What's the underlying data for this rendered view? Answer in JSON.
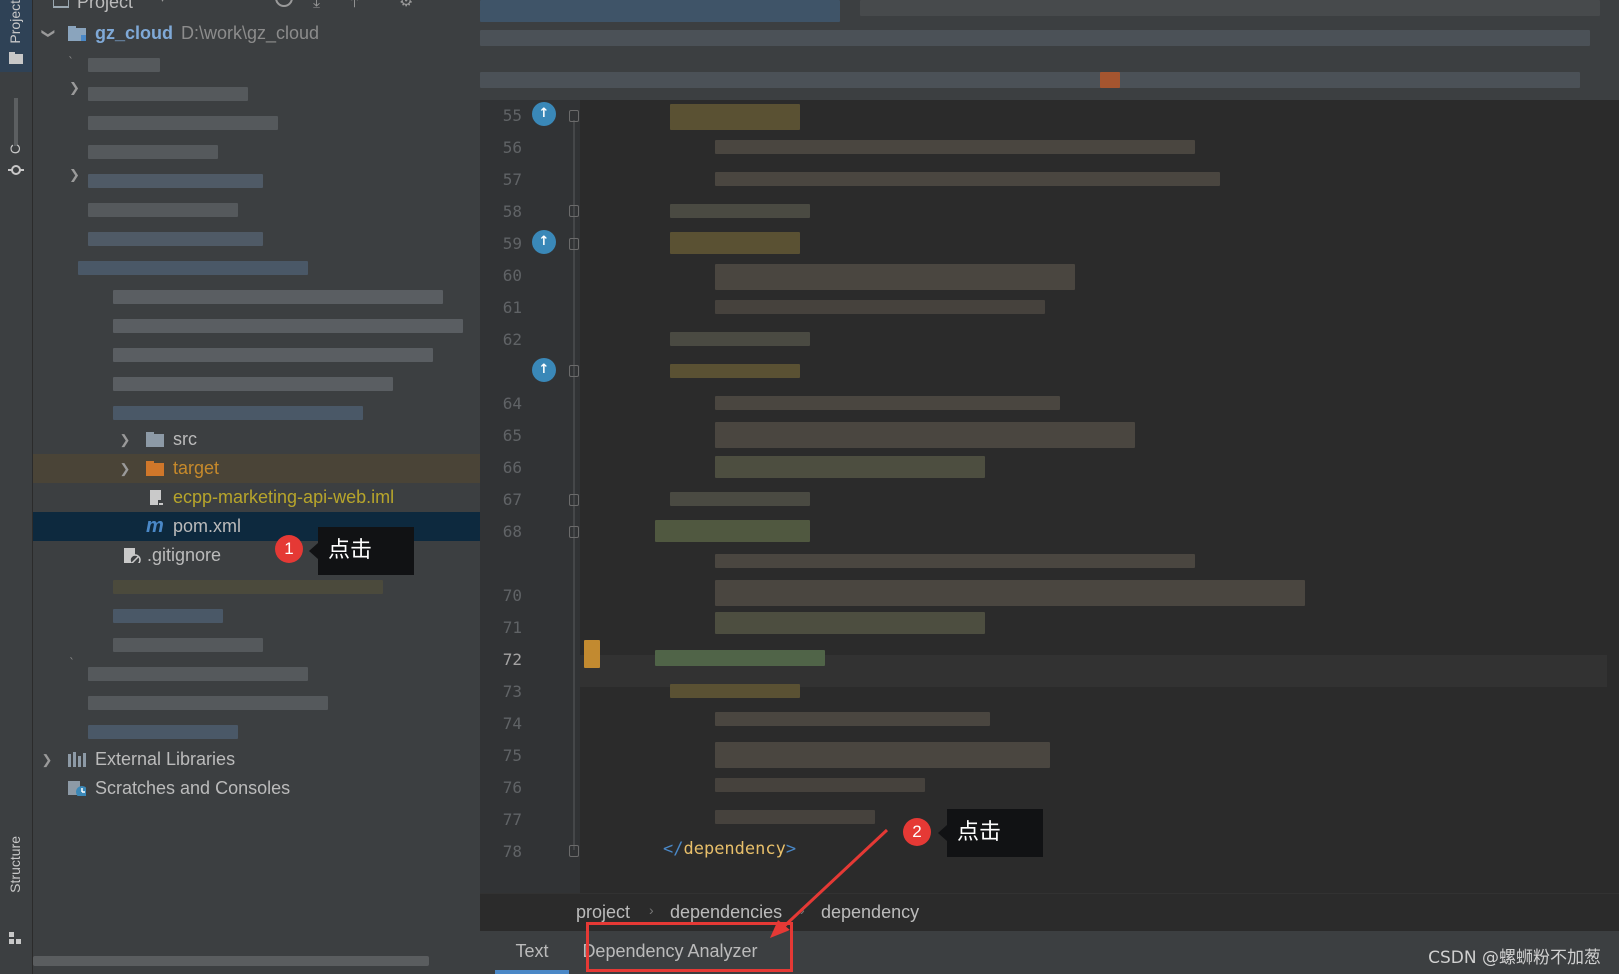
{
  "colors": {
    "accent": "#4a88c7",
    "annotation": "#e53935",
    "selected_row": "#0d293e",
    "excluded_row": "#4a4437",
    "excluded_text": "#c78a2b",
    "iml_text": "#b7a52b"
  },
  "tool_strip": {
    "project_tab": "Project",
    "commit_tab": "C",
    "structure_tab": "Structure"
  },
  "project_panel": {
    "header_title": "Project",
    "root": {
      "name": "gz_cloud",
      "path": "D:\\work\\gz_cloud",
      "icon": "module-folder-icon"
    },
    "items": [
      {
        "label": "src",
        "icon": "folder-icon"
      },
      {
        "label": "target",
        "icon": "folder-excluded-icon"
      },
      {
        "label": "ecpp-marketing-api-web.iml",
        "icon": "iml-file-icon"
      },
      {
        "label": "pom.xml",
        "icon": "maven-m-icon"
      },
      {
        "label": ".gitignore",
        "icon": "ignore-file-icon"
      }
    ],
    "external_libraries": "External Libraries",
    "scratches": "Scratches and Consoles"
  },
  "editor": {
    "line_numbers": [
      "55",
      "56",
      "57",
      "58",
      "59",
      "60",
      "61",
      "62",
      "64",
      "65",
      "66",
      "67",
      "68",
      "70",
      "71",
      "72",
      "73",
      "74",
      "75",
      "76",
      "77",
      "78"
    ],
    "current_line": "72",
    "closing_tag_prefix": "</",
    "closing_tag_name": "dependency",
    "closing_tag_suffix": ">"
  },
  "breadcrumbs": [
    "project",
    "dependencies",
    "dependency"
  ],
  "bottom_tabs": [
    "Text",
    "Dependency Analyzer"
  ],
  "annotations": [
    {
      "number": "1",
      "text": "点击"
    },
    {
      "number": "2",
      "text": "点击"
    }
  ],
  "watermark": "CSDN @螺蛳粉不加葱"
}
